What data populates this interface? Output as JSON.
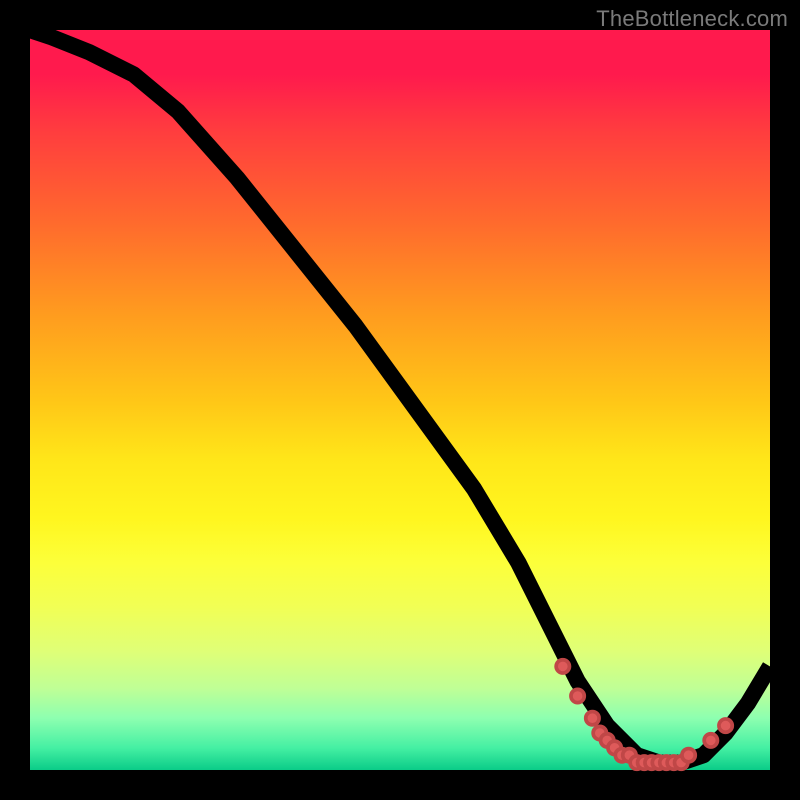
{
  "attribution": "TheBottleneck.com",
  "colors": {
    "dot_fill": "#de5a5a",
    "dot_stroke": "#c04747",
    "line": "#000000"
  },
  "chart_data": {
    "type": "line",
    "title": "",
    "xlabel": "",
    "ylabel": "",
    "xlim": [
      0,
      100
    ],
    "ylim": [
      0,
      100
    ],
    "series": [
      {
        "name": "bottleneck-curve",
        "x": [
          0,
          3,
          8,
          14,
          20,
          28,
          36,
          44,
          52,
          60,
          66,
          70,
          74,
          78,
          82,
          85,
          88,
          91,
          94,
          97,
          100
        ],
        "y": [
          100,
          99,
          97,
          94,
          89,
          80,
          70,
          60,
          49,
          38,
          28,
          20,
          12,
          6,
          2,
          1,
          1,
          2,
          5,
          9,
          14
        ]
      }
    ],
    "highlight_dots": {
      "name": "trough-markers",
      "x": [
        72,
        74,
        76,
        77,
        78,
        79,
        80,
        81,
        82,
        83,
        84,
        85,
        86,
        87,
        88,
        89,
        92,
        94
      ],
      "y": [
        14,
        10,
        7,
        5,
        4,
        3,
        2,
        2,
        1,
        1,
        1,
        1,
        1,
        1,
        1,
        2,
        4,
        6
      ]
    }
  }
}
